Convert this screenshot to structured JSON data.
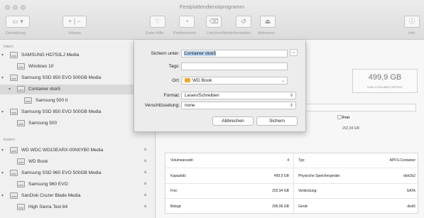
{
  "window": {
    "title": "Festplattendienstprogramm"
  },
  "toolbar": {
    "darstellung": "Darstellung",
    "volume": "Volume",
    "erste_hilfe": "Erste Hilfe",
    "partitionieren": "Partitionieren",
    "loeschen": "Löschen",
    "wiederherstellen": "Wiederherstellen",
    "aktivieren": "Aktivieren",
    "info": "Info"
  },
  "sidebar": {
    "intern_label": "Intern",
    "extern_label": "Extern",
    "intern": [
      {
        "name": "SAMSUNG HD753LJ Media",
        "level": 0,
        "expanded": true
      },
      {
        "name": "Windows 10",
        "level": 1
      },
      {
        "name": "Samsung SSD 850 EVO 500GB Media",
        "level": 0,
        "expanded": true
      },
      {
        "name": "Container disk5",
        "level": 1,
        "expanded": true,
        "selected": true
      },
      {
        "name": "Samsung 500 II",
        "level": 2
      },
      {
        "name": "Samsung SSD 850 EVO 500GB Media",
        "level": 0,
        "expanded": true
      },
      {
        "name": "Samsung 500",
        "level": 1
      }
    ],
    "extern": [
      {
        "name": "WD WDC WD10EARX-00N0YB0 Media",
        "level": 0,
        "expanded": true,
        "eject": "≜"
      },
      {
        "name": "WD Book",
        "level": 1,
        "eject": "≜"
      },
      {
        "name": "Samsung SSD 960 EVO 500GB Media",
        "level": 0,
        "expanded": true,
        "eject": "≜"
      },
      {
        "name": "Samsung 960 EVO",
        "level": 1,
        "eject": "≜"
      },
      {
        "name": "SanDisk Cruzer Blade Media",
        "level": 0,
        "expanded": true,
        "eject": "≜"
      },
      {
        "name": "High Sierra Test 64",
        "level": 1,
        "eject": "≜"
      }
    ]
  },
  "main": {
    "capacity": "499,9 GB",
    "capacity_shared": "VON 4 VOLUMES GETEILT",
    "usage_fraction": 0.065,
    "free_label": "Frei",
    "free_value": "202,94 GB",
    "info_rows": [
      {
        "left_label": "Volumeanzahl:",
        "left_value": "4",
        "right_label": "Typ:",
        "right_value": "APFS-Container"
      },
      {
        "left_label": "Kapazität:",
        "left_value": "499,9 GB",
        "right_label": "Physische Speichergeräte:",
        "right_value": "disk3s2"
      },
      {
        "left_label": "Frei:",
        "left_value": "202,94 GB",
        "right_label": "Verbindung:",
        "right_value": "SATA"
      },
      {
        "left_label": "Belegt:",
        "left_value": "296,96 GB",
        "right_label": "Gerät:",
        "right_value": "disk5"
      }
    ]
  },
  "dialog": {
    "save_as_label": "Sichern unter:",
    "save_as_value": "Container disk5",
    "tags_label": "Tags:",
    "tags_value": "",
    "location_label": "Ort:",
    "location_value": "WD Book",
    "format_label": "Format:",
    "format_value": "Lesen/Schreiben",
    "encryption_label": "Verschlüsselung:",
    "encryption_value": "none",
    "cancel_label": "Abbrechen",
    "save_label": "Sichern",
    "expand_glyph": "⌄"
  },
  "colors": {
    "usage": "#1e9fe0",
    "selection": "#d9d9d9",
    "folder": "#f0a92c"
  }
}
